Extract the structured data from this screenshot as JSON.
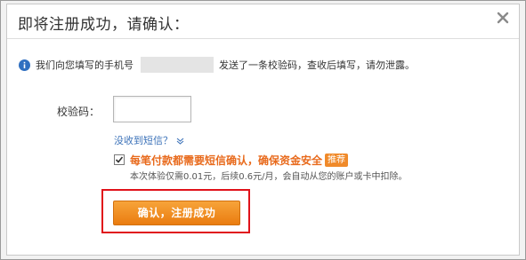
{
  "dialog": {
    "title": "即将注册成功，请确认：",
    "close_icon": "close-icon"
  },
  "info": {
    "icon": "info-icon",
    "text_before": "我们向您填写的手机号",
    "text_after": "发送了一条校验码，查收后填写，请勿泄露。"
  },
  "form": {
    "code_label": "校验码：",
    "code_value": "",
    "resend_link": "没收到短信？",
    "resend_icon": "chevron-down-icon"
  },
  "sms_option": {
    "checked": true,
    "title": "每笔付款都需要短信确认，确保资金安全",
    "badge": "推荐",
    "description": "本次体验仅需0.01元，后续0.6元/月，会自动从您的账户或卡中扣除。"
  },
  "actions": {
    "confirm_label": "确认，注册成功"
  },
  "colors": {
    "accent_orange": "#ea7c10",
    "link_blue": "#3d73b9",
    "highlight_red": "#e0121a",
    "info_blue": "#2f6fc0"
  }
}
